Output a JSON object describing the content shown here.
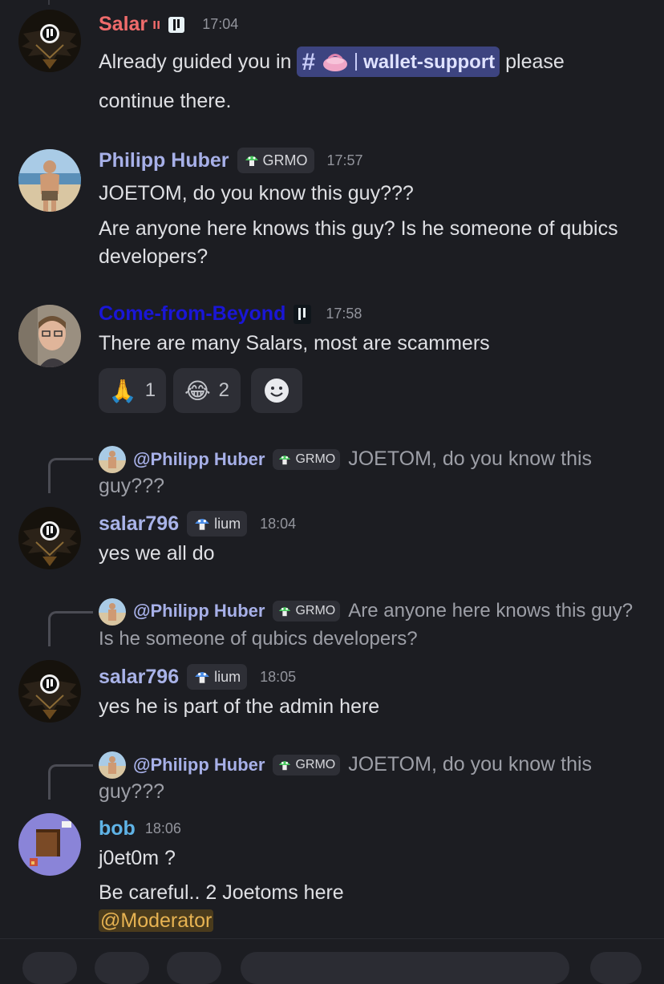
{
  "messages": {
    "m1": {
      "author": "Salar",
      "author_color": "#ef6b6b",
      "role_glyph": "ıı",
      "time": "17:04",
      "text_before": "Already guided you in",
      "channel_hash": "#",
      "channel_emoji": "purse-icon",
      "channel_label": "wallet-support",
      "text_after": "please",
      "text_line2": "continue there."
    },
    "m2": {
      "author": "Philipp Huber",
      "author_color": "#a7b0e8",
      "tag": "GRMO",
      "time": "17:57",
      "line1": "JOETOM, do you know this guy???",
      "line2": "Are anyone here knows this guy? Is he someone of qubics",
      "line3": "developers?"
    },
    "m3": {
      "author": "Come-from-Beyond",
      "author_color": "#1a16d6",
      "time": "17:58",
      "text": "There are many Salars, most are scammers",
      "reactions": [
        {
          "emoji": "🙏",
          "count": "1"
        },
        {
          "emoji": "😂",
          "count": "2"
        }
      ],
      "add_reaction_icon": "smiley-add-icon"
    },
    "m4": {
      "reply_author": "@Philipp Huber",
      "reply_tag": "GRMO",
      "reply_text1": "JOETOM, do you know this",
      "reply_text2": "guy???",
      "author": "salar796",
      "author_color": "#a9b3e8",
      "tag": "lium",
      "time": "18:04",
      "text": "yes we all do"
    },
    "m5": {
      "reply_author": "@Philipp Huber",
      "reply_tag": "GRMO",
      "reply_text1": "Are anyone here knows this guy?",
      "reply_text2": "Is he someone of qubics developers?",
      "author": "salar796",
      "author_color": "#a9b3e8",
      "tag": "lium",
      "time": "18:05",
      "text": "yes he is part of the admin here"
    },
    "m6": {
      "reply_author": "@Philipp Huber",
      "reply_tag": "GRMO",
      "reply_text1": "JOETOM, do you know this",
      "reply_text2": "guy???",
      "author": "bob",
      "author_color": "#5fb3e6",
      "time": "18:06",
      "line1": "j0et0m ?",
      "line2": "Be careful.. 2 Joetoms here",
      "mention": "@Moderator"
    }
  },
  "colors": {
    "background": "#1c1d22",
    "mention_bg": "#4a3b1c",
    "mention_fg": "#e7b352",
    "channel_bg": "#3d4480"
  }
}
